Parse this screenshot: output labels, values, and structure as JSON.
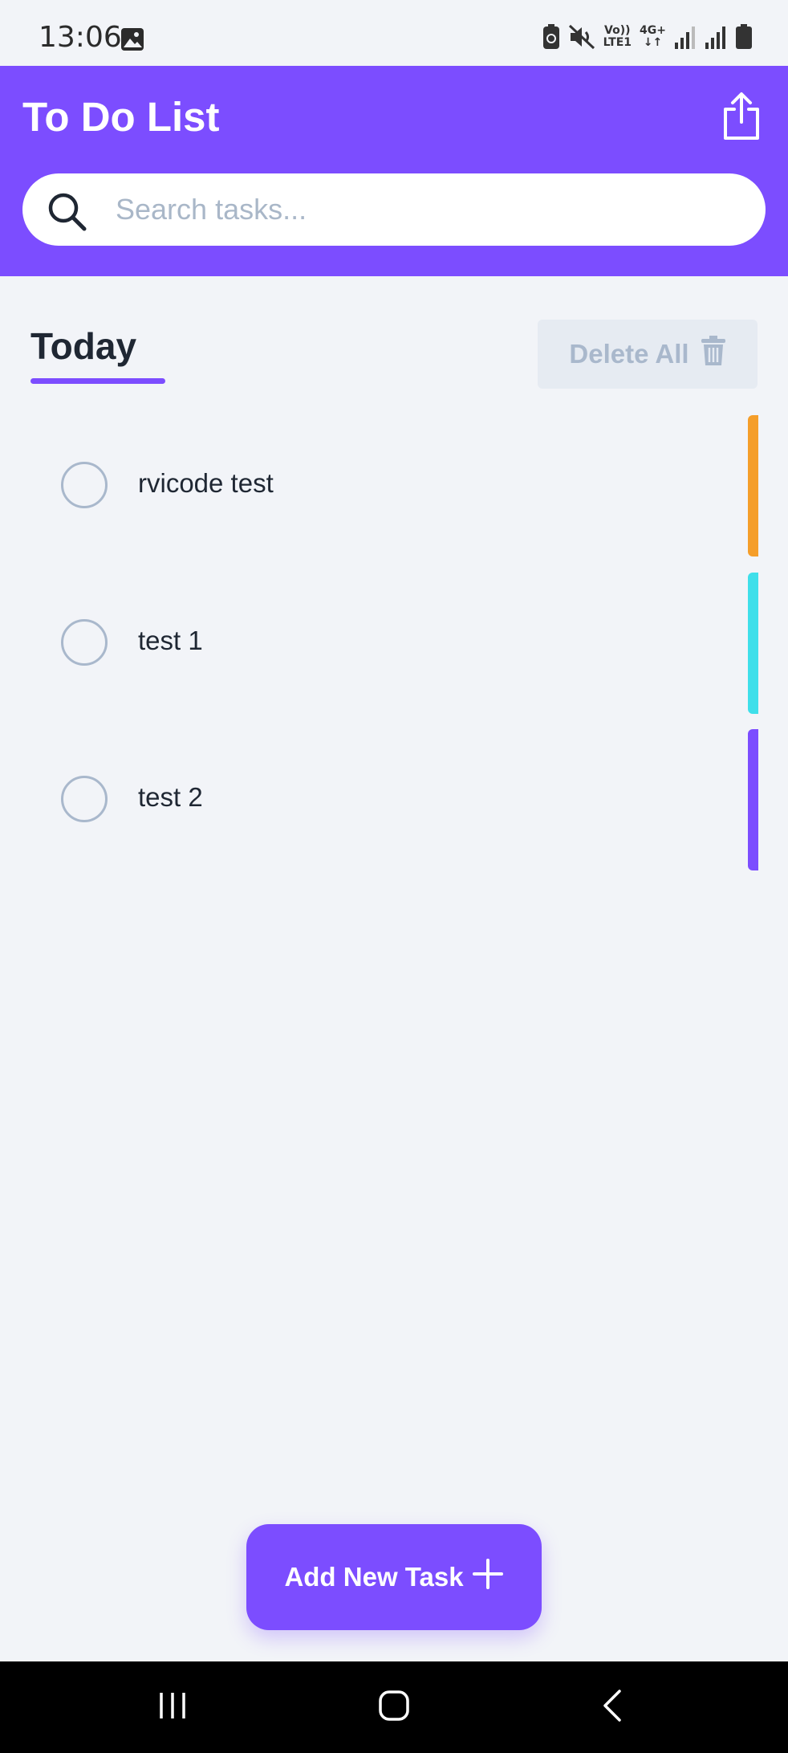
{
  "status_bar": {
    "time": "13:06",
    "network_label_top": "Vo))",
    "network_label_bottom": "LTE1",
    "network_type": "4G+",
    "icons": [
      "gallery-icon",
      "battery-saver-icon",
      "mute-icon",
      "volte-icon",
      "data-arrows-icon",
      "signal-icon",
      "signal-icon",
      "battery-icon"
    ]
  },
  "header": {
    "title": "To Do List",
    "share_icon": "share-icon"
  },
  "search": {
    "placeholder": "Search tasks...",
    "value": ""
  },
  "section": {
    "title": "Today",
    "delete_all_label": "Delete All"
  },
  "tasks": [
    {
      "label": "rvicode test",
      "color": "#f59e2a",
      "completed": false
    },
    {
      "label": "test 1",
      "color": "#3fdfea",
      "completed": false
    },
    {
      "label": "test 2",
      "color": "#7c4dff",
      "completed": false
    }
  ],
  "add_button": {
    "label": "Add New Task"
  },
  "nav": {
    "items": [
      "recents-icon",
      "home-icon",
      "back-icon"
    ]
  },
  "colors": {
    "accent": "#7c4dff",
    "background": "#f2f4f8",
    "muted": "#a9b8cc"
  }
}
